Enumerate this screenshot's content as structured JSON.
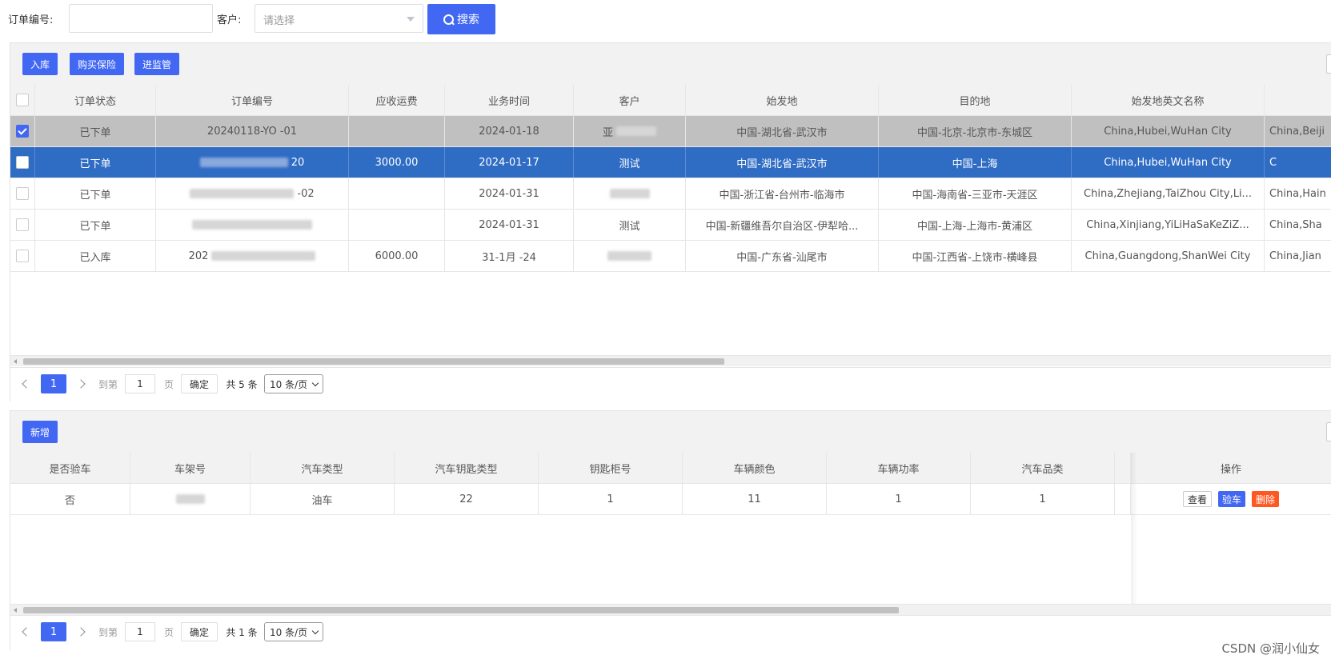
{
  "search": {
    "order_no_label": "订单编号:",
    "order_no_value": "",
    "customer_label": "客户:",
    "customer_placeholder": "请选择",
    "search_button": "搜索"
  },
  "orders": {
    "toolbar": {
      "btn_inbound": "入库",
      "btn_insurance": "购买保险",
      "btn_supervise": "进监管"
    },
    "columns": [
      "订单状态",
      "订单编号",
      "应收运费",
      "业务时间",
      "客户",
      "始发地",
      "目的地",
      "始发地英文名称",
      "目"
    ],
    "rows": [
      {
        "checked": true,
        "state": "selected",
        "status": "已下单",
        "order_no": "20240118-YO      -01",
        "freight": "",
        "time": "2024-01-18",
        "customer": "亚",
        "origin": "中国-湖北省-武汉市",
        "dest": "中国-北京-北京市-东城区",
        "origin_en": "China,Hubei,WuHan City",
        "dest_en": "China,Beiji"
      },
      {
        "checked": false,
        "state": "active",
        "status": "已下单",
        "order_no": "20",
        "freight": "3000.00",
        "time": "2024-01-17",
        "customer": "测试",
        "origin": "中国-湖北省-武汉市",
        "dest": "中国-上海",
        "origin_en": "China,Hubei,WuHan City",
        "dest_en": "C"
      },
      {
        "checked": false,
        "state": "",
        "status": "已下单",
        "order_no": "-02",
        "freight": "",
        "time": "2024-01-31",
        "customer": "",
        "origin": "中国-浙江省-台州市-临海市",
        "dest": "中国-海南省-三亚市-天涯区",
        "origin_en": "China,Zhejiang,TaiZhou City,Li...",
        "dest_en": "China,Hain"
      },
      {
        "checked": false,
        "state": "",
        "status": "已下单",
        "order_no": "",
        "freight": "",
        "time": "2024-01-31",
        "customer": "测试",
        "origin": "中国-新疆维吾尔自治区-伊犁哈...",
        "dest": "中国-上海-上海市-黄浦区",
        "origin_en": "China,Xinjiang,YiLiHaSaKeZiZ...",
        "dest_en": "China,Sha"
      },
      {
        "checked": false,
        "state": "",
        "status": "已入库",
        "order_no": "202",
        "freight": "6000.00",
        "time": "31-1月 -24",
        "customer": "",
        "origin": "中国-广东省-汕尾市",
        "dest": "中国-江西省-上饶市-横峰县",
        "origin_en": "China,Guangdong,ShanWei City",
        "dest_en": "China,Jian"
      }
    ],
    "pager": {
      "current": "1",
      "goto_label": "到第",
      "goto_value": "1",
      "page_label": "页",
      "confirm": "确定",
      "total": "共 5 条",
      "per_page": "10 条/页"
    }
  },
  "vehicles": {
    "toolbar": {
      "btn_add": "新增"
    },
    "columns": [
      "是否验车",
      "车架号",
      "汽车类型",
      "汽车钥匙类型",
      "钥匙柜号",
      "车辆颜色",
      "车辆功率",
      "汽车品类",
      "操作"
    ],
    "rows": [
      {
        "inspected": "否",
        "vin": "",
        "car_type": "油车",
        "key_type": "22",
        "key_cabinet": "1",
        "color": "11",
        "power": "1",
        "category": "1",
        "ops": {
          "view": "查看",
          "inspect": "验车",
          "delete": "删除"
        }
      }
    ],
    "pager": {
      "current": "1",
      "goto_label": "到第",
      "goto_value": "1",
      "page_label": "页",
      "confirm": "确定",
      "total": "共 1 条",
      "per_page": "10 条/页"
    }
  },
  "watermark": "CSDN @润小仙女"
}
